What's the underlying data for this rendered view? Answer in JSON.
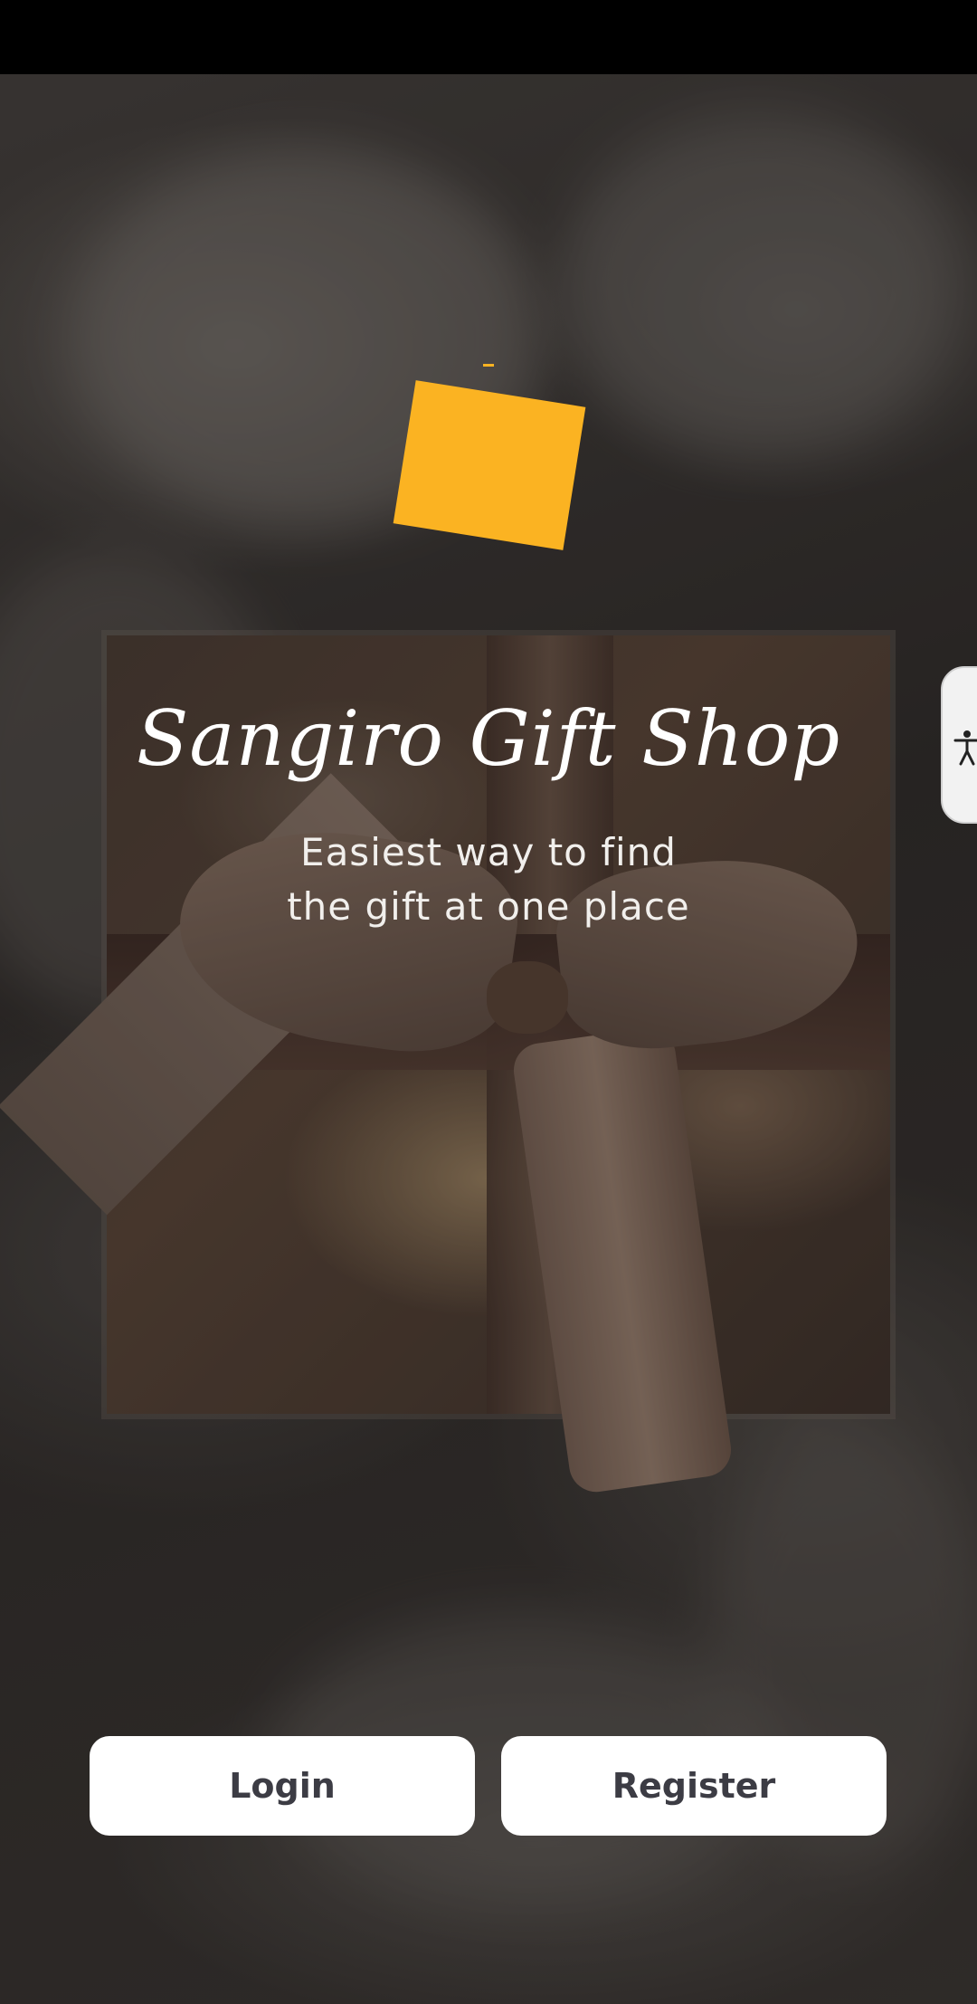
{
  "app": {
    "title": "Sangiro Gift Shop",
    "tagline_line1": "Easiest way to find",
    "tagline_line2": "the gift at one place"
  },
  "logo": {
    "icon": "gift-logo-icon",
    "color": "#FBB322"
  },
  "actions": {
    "login_label": "Login",
    "register_label": "Register"
  },
  "accessibility": {
    "icon": "accessibility-person-icon"
  },
  "colors": {
    "accent": "#FBB322",
    "button_bg": "#FFFFFF",
    "button_text": "#3C3C44",
    "title_text": "#FFFFFF"
  }
}
